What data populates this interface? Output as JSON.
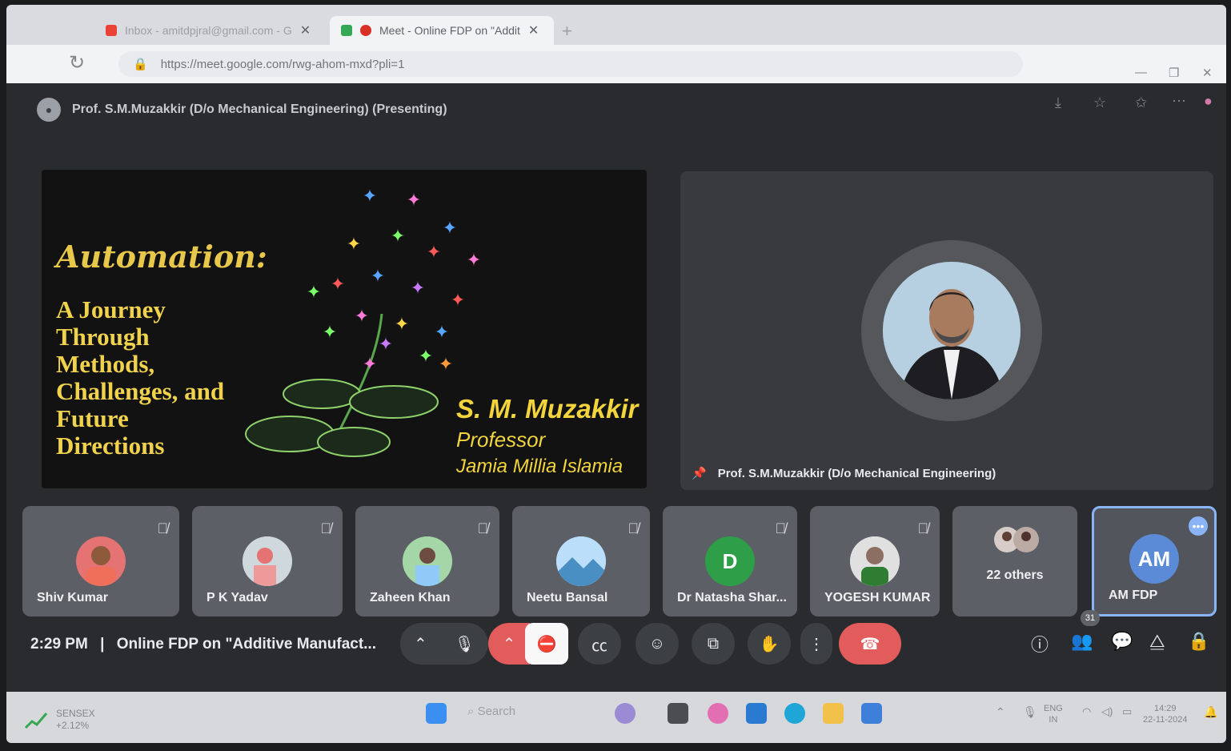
{
  "browser": {
    "tabs": [
      {
        "label": "Inbox - amitdpjral@gmail.com - G"
      },
      {
        "label": "Meet - Online FDP on \"Addit"
      }
    ],
    "new_tab": "+",
    "url": "https://meet.google.com/rwg-ahom-mxd?pli=1"
  },
  "meet": {
    "presenter_banner": "Prof. S.M.Muzakkir (D/o Mechanical Engineering) (Presenting)",
    "slide": {
      "title": "Automation:",
      "subtitle_lines": [
        "A Journey",
        "Through",
        "Methods,",
        "Challenges, and",
        "Future",
        "Directions"
      ],
      "author_name": "S. M. Muzakkir",
      "author_role": "Professor",
      "author_org": "Jamia Millia Islamia"
    },
    "pinned_label": "Prof. S.M.Muzakkir (D/o Mechanical Engineering)",
    "participants": [
      {
        "name": "Shiv Kumar",
        "color": "#e57373"
      },
      {
        "name": "P K Yadav",
        "color": "#b0bec5"
      },
      {
        "name": "Zaheen Khan",
        "color": "#81c784"
      },
      {
        "name": "Neetu Bansal",
        "color": "#90caf9"
      },
      {
        "name": "Dr Natasha Shar...",
        "initial": "D",
        "color": "#2e9e48"
      },
      {
        "name": "YOGESH KUMAR",
        "color": "#cfd8dc"
      }
    ],
    "others_label": "22 others",
    "self": {
      "initials": "AM",
      "name": "AM FDP",
      "color": "#5b8bd6"
    },
    "time": "2:29 PM",
    "separator": "|",
    "meeting_title": "Online FDP on \"Additive Manufact...",
    "people_count": "31"
  },
  "taskbar": {
    "sensex_label": "SENSEX",
    "sensex_change": "+2.12%",
    "search_placeholder": "Search",
    "lang_top": "ENG",
    "lang_bottom": "IN",
    "clock_time": "14:29",
    "clock_date": "22-11-2024"
  }
}
